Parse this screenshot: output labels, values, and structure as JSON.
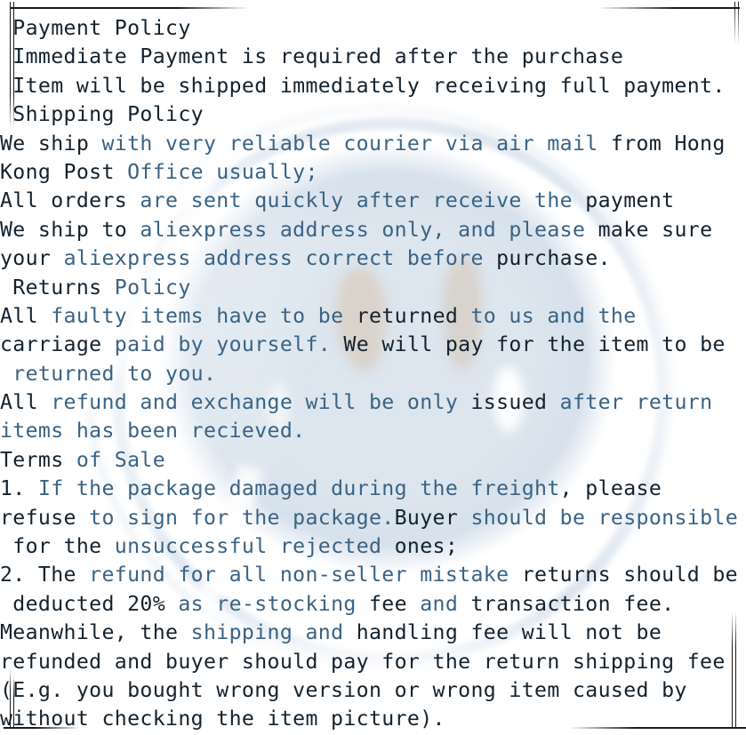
{
  "document": {
    "kind": "seller-policy-text",
    "colors": {
      "ink_black": "#13222e",
      "ink_blue": "#3a6384",
      "ink_blue_dark": "#2d5878",
      "background": "#ffffff",
      "watermark_blue": "#dde5ee",
      "watermark_ring": "#ccd8e6",
      "watermark_tan": "#d8cec2",
      "crop_mark": "#1a1a1a"
    },
    "sections": [
      {
        "heading": "Payment Policy",
        "lines": [
          " Immediate Payment is required after the purchase",
          " Item will be shipped immediately receiving full payment."
        ]
      },
      {
        "heading": "Shipping Policy",
        "lines": [
          "We ship with very reliable courier via air mail from Hong",
          "Kong Post Office usually;",
          "All orders are sent quickly after receive the payment",
          "We ship to aliexpress address only, and please make sure",
          "your aliexpress address correct before purchase."
        ]
      },
      {
        "heading": "Returns Policy",
        "lines": [
          "All faulty items have to be returned to us and the",
          "carriage paid by yourself. We will pay for the item to be",
          " returned to you.",
          "All refund and exchange will be only issued after return",
          "items has been recieved."
        ]
      },
      {
        "heading": "Terms of Sale",
        "lines": [
          "1. If the package damaged during the freight, please",
          "refuse to sign for the package.Buyer should be responsible",
          " for the unsuccessful rejected ones;",
          "2. The refund for all non-seller mistake returns should be",
          " deducted 20% as re-stocking fee and transaction fee.",
          "Meanwhile, the shipping and handling fee will not be",
          "refunded and buyer should pay for the return shipping fee",
          "(E.g. you bought wrong version or wrong item caused by",
          "without checking the item picture)."
        ]
      }
    ],
    "rendered_lines": [
      {
        "id": "l01",
        "text": " Payment Policy"
      },
      {
        "id": "l02",
        "text": " Immediate Payment is required after the purchase"
      },
      {
        "id": "l03",
        "text": " Item will be shipped immediately receiving full payment."
      },
      {
        "id": "l04",
        "text": " Shipping Policy"
      },
      {
        "id": "l05",
        "text": "We ship with very reliable courier via air mail from Hong"
      },
      {
        "id": "l06",
        "text": "Kong Post Office usually;"
      },
      {
        "id": "l07",
        "text": "All orders are sent quickly after receive the payment"
      },
      {
        "id": "l08",
        "text": "We ship to aliexpress address only, and please make sure"
      },
      {
        "id": "l09",
        "text": "your aliexpress address correct before purchase."
      },
      {
        "id": "l10",
        "text": " Returns Policy"
      },
      {
        "id": "l11",
        "text": "All faulty items have to be returned to us and the"
      },
      {
        "id": "l12",
        "text": "carriage paid by yourself. We will pay for the item to be"
      },
      {
        "id": "l13",
        "text": " returned to you."
      },
      {
        "id": "l14",
        "text": "All refund and exchange will be only issued after return"
      },
      {
        "id": "l15",
        "text": "items has been recieved."
      },
      {
        "id": "l16",
        "text": "Terms of Sale"
      },
      {
        "id": "l17",
        "text": "1. If the package damaged during the freight, please"
      },
      {
        "id": "l18",
        "text": "refuse to sign for the package.Buyer should be responsible"
      },
      {
        "id": "l19",
        "text": " for the unsuccessful rejected ones;"
      },
      {
        "id": "l20",
        "text": "2. The refund for all non-seller mistake returns should be"
      },
      {
        "id": "l21",
        "text": " deducted 20% as re-stocking fee and transaction fee."
      },
      {
        "id": "l22",
        "text": "Meanwhile, the shipping and handling fee will not be"
      },
      {
        "id": "l23",
        "text": "refunded and buyer should pay for the return shipping fee"
      },
      {
        "id": "l24",
        "text": "(E.g. you bought wrong version or wrong item caused by"
      },
      {
        "id": "l25",
        "text": "without checking the item picture)."
      }
    ],
    "line_runs": [
      [
        [
          " Payment Policy",
          "k"
        ]
      ],
      [
        [
          " Immediate Payment is required after the purchase",
          "k"
        ]
      ],
      [
        [
          " Item will be shipped immediately receiving full payment.",
          "k"
        ]
      ],
      [
        [
          " Shipping Policy",
          "k"
        ]
      ],
      [
        [
          "We ship ",
          "k"
        ],
        [
          "with very reliable courier via air mail ",
          "b"
        ],
        [
          "from Hong",
          "k"
        ]
      ],
      [
        [
          "Kong Post ",
          "k"
        ],
        [
          "Office usually;",
          "b"
        ]
      ],
      [
        [
          "All orders ",
          "k"
        ],
        [
          "are sent quickly after receive the ",
          "b"
        ],
        [
          "payment",
          "k"
        ]
      ],
      [
        [
          "We ship to ",
          "k"
        ],
        [
          "aliexpress address only, and please ",
          "b"
        ],
        [
          "make sure",
          "k"
        ]
      ],
      [
        [
          "your ",
          "k"
        ],
        [
          "aliexpress address correct before ",
          "b"
        ],
        [
          "purchase.",
          "k"
        ]
      ],
      [
        [
          " Returns ",
          "k"
        ],
        [
          "Policy",
          "b"
        ]
      ],
      [
        [
          "All ",
          "k"
        ],
        [
          "faulty items have to be ",
          "b"
        ],
        [
          "returned ",
          "k"
        ],
        [
          "to us and the",
          "b"
        ]
      ],
      [
        [
          "carriage ",
          "k"
        ],
        [
          "paid by yourself. ",
          "b"
        ],
        [
          "We will pay for the item to be",
          "k"
        ]
      ],
      [
        [
          " returned to you.",
          "b"
        ]
      ],
      [
        [
          "All ",
          "k"
        ],
        [
          "refund and exchange will be only ",
          "b"
        ],
        [
          "issued ",
          "k"
        ],
        [
          "after return",
          "b"
        ]
      ],
      [
        [
          "items has been recieved.",
          "b"
        ]
      ],
      [
        [
          "Terms ",
          "k"
        ],
        [
          "of Sale",
          "b"
        ]
      ],
      [
        [
          "1. ",
          "k"
        ],
        [
          "If the package damaged during the freight",
          "b"
        ],
        [
          ", please",
          "k"
        ]
      ],
      [
        [
          "refuse ",
          "k"
        ],
        [
          "to sign for the package.",
          "b"
        ],
        [
          "Buyer ",
          "k"
        ],
        [
          "should be responsible",
          "b"
        ]
      ],
      [
        [
          " for the ",
          "k"
        ],
        [
          "unsuccessful rejected ",
          "b"
        ],
        [
          "ones;",
          "k"
        ]
      ],
      [
        [
          "2. The ",
          "k"
        ],
        [
          "refund for all non-seller mistake ",
          "b"
        ],
        [
          "returns should be",
          "k"
        ]
      ],
      [
        [
          " deducted 20% ",
          "k"
        ],
        [
          "as re-stocking ",
          "b"
        ],
        [
          "fee ",
          "k"
        ],
        [
          "and ",
          "b"
        ],
        [
          "transaction fee.",
          "k"
        ]
      ],
      [
        [
          "Meanwhile, the ",
          "k"
        ],
        [
          "shipping and ",
          "b"
        ],
        [
          "handling fee will not be",
          "k"
        ]
      ],
      [
        [
          "refunded and buyer should pay for the return shipping fee",
          "k"
        ]
      ],
      [
        [
          "(E.g. you bought wrong version or wrong item caused by",
          "k"
        ]
      ],
      [
        [
          "without checking the item picture).",
          "k"
        ]
      ]
    ]
  }
}
